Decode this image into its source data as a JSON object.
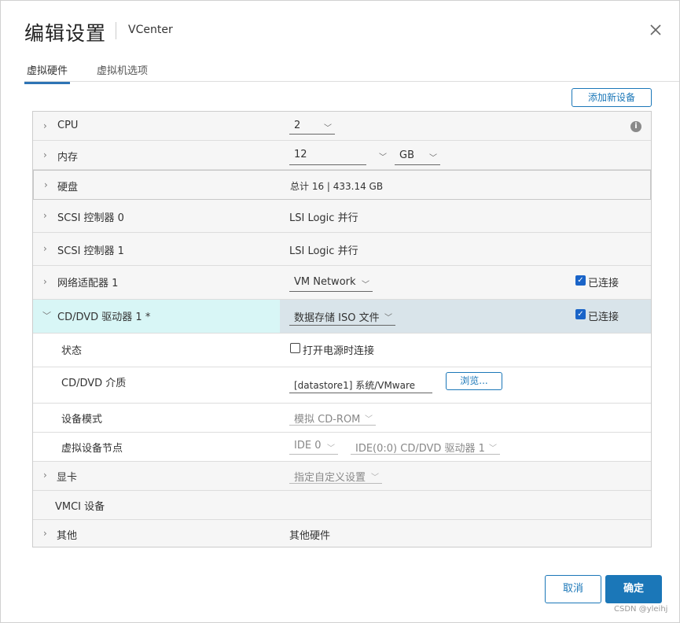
{
  "dialog": {
    "title": "编辑设置",
    "subtitle": "VCenter",
    "close_icon": "close-icon"
  },
  "tabs": [
    {
      "label": "虚拟硬件",
      "active": true
    },
    {
      "label": "虚拟机选项",
      "active": false
    }
  ],
  "add_device_label": "添加新设备",
  "hardware": {
    "cpu": {
      "label": "CPU",
      "value": "2"
    },
    "memory": {
      "label": "内存",
      "value": "12",
      "unit": "GB"
    },
    "disk": {
      "label": "硬盘",
      "value": "总计 16 | 433.14 GB"
    },
    "scsi0": {
      "label": "SCSI 控制器 0",
      "value": "LSI Logic 并行"
    },
    "scsi1": {
      "label": "SCSI 控制器 1",
      "value": "LSI Logic 并行"
    },
    "network": {
      "label": "网络适配器 1",
      "value": "VM Network",
      "connected_label": "已连接",
      "connected": true
    },
    "cdrom": {
      "label": "CD/DVD 驱动器 1 *",
      "value": "数据存储 ISO 文件",
      "connected_label": "已连接",
      "connected": true,
      "status_label": "状态",
      "power_on_label": "打开电源时连接",
      "power_on_connect": false,
      "media_label": "CD/DVD 介质",
      "media_value": "[datastore1] 系统/VMware",
      "browse_label": "浏览...",
      "device_mode_label": "设备模式",
      "device_mode_value": "模拟 CD-ROM",
      "node_label": "虚拟设备节点",
      "node_bus": "IDE 0",
      "node_slot": "IDE(0:0) CD/DVD 驱动器 1"
    },
    "video": {
      "label": "显卡",
      "value": "指定自定义设置"
    },
    "vmci": {
      "label": "VMCI 设备"
    },
    "other": {
      "label": "其他",
      "value": "其他硬件"
    }
  },
  "footer": {
    "cancel_label": "取消",
    "ok_label": "确定"
  },
  "watermark": "CSDN @yleihj",
  "colors": {
    "accent": "#1b77b8",
    "cdrom_row_bg": "#d8f6f6",
    "cdrom_value_bg": "#d9e4ea"
  }
}
